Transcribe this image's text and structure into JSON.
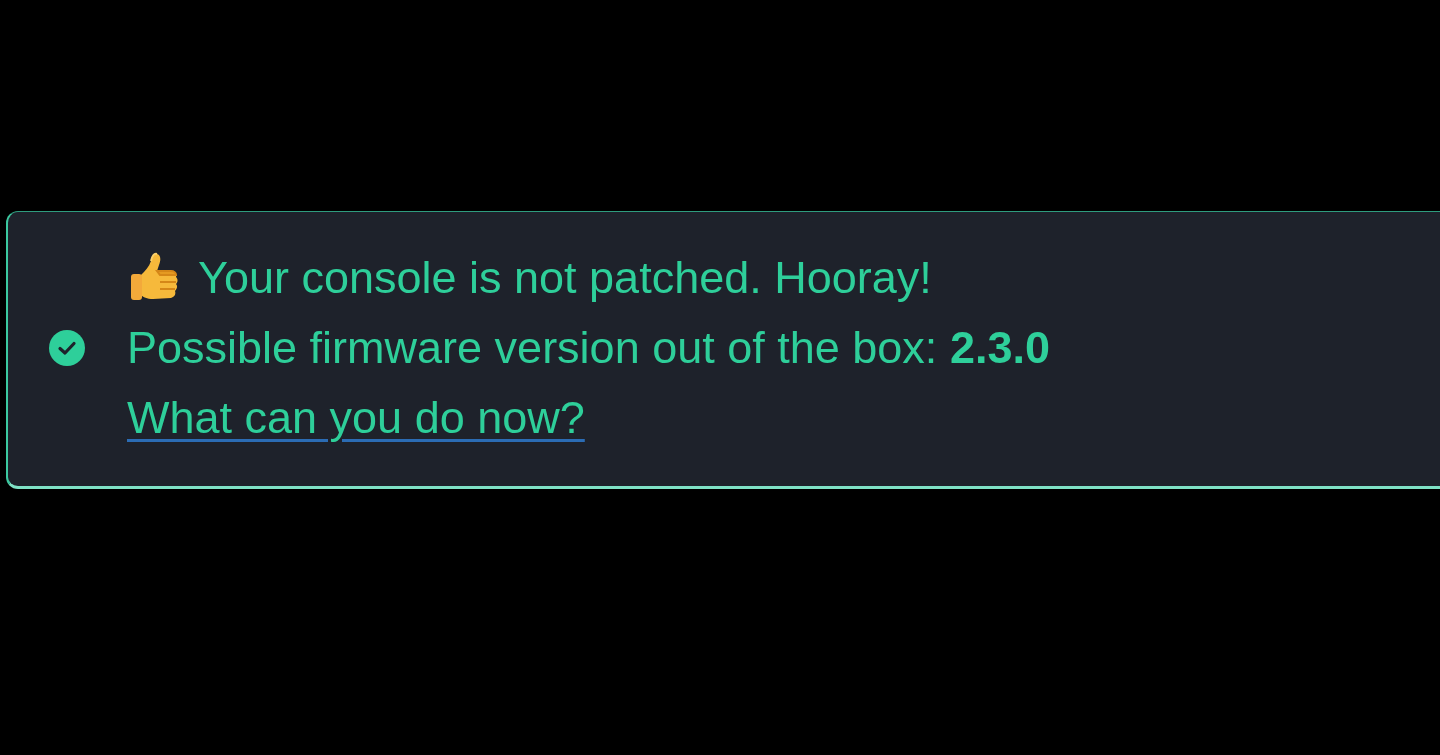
{
  "result_panel": {
    "messages": [
      {
        "kind": "thumbs-up",
        "text": "Your console is not patched. Hooray!"
      },
      {
        "kind": "check",
        "text": "Possible firmware version out of the box: **2.3.0**"
      },
      {
        "kind": "link",
        "text": "What can you do now?"
      }
    ]
  }
}
